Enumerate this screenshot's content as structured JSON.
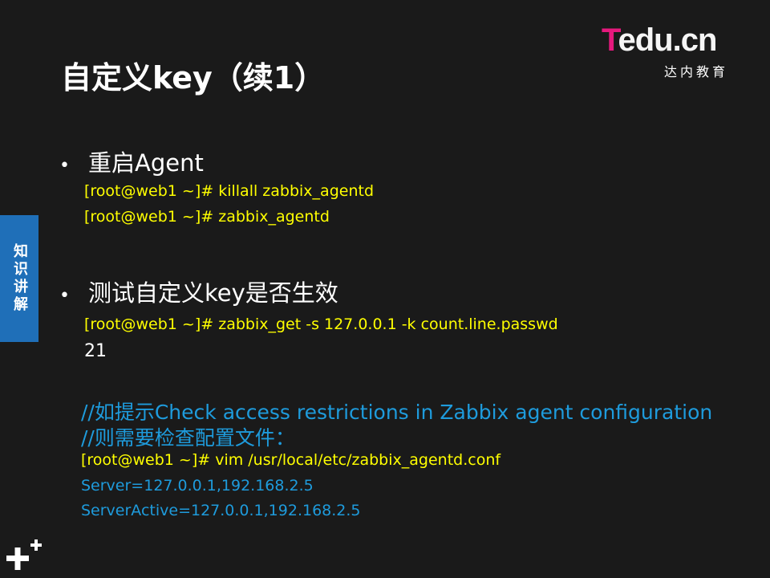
{
  "title": "自定义key（续1）",
  "logo": {
    "brand_t": "T",
    "brand_rest": "edu.cn",
    "subtitle": "达内教育"
  },
  "side_tab": "知识讲解",
  "sections": [
    {
      "bullet": "•",
      "heading": "重启Agent",
      "commands": [
        "[root@web1 ~]# killall  zabbix_agentd",
        "[root@web1 ~]# zabbix_agentd"
      ]
    },
    {
      "bullet": "•",
      "heading": "测试自定义key是否生效",
      "commands": [
        "[root@web1 ~]# zabbix_get -s 127.0.0.1 -k count.line.passwd"
      ],
      "output": "21"
    }
  ],
  "notes": [
    "//如提示Check access restrictions in Zabbix agent configuration",
    "//则需要检查配置文件："
  ],
  "config_command": "[root@web1 ~]# vim /usr/local/etc/zabbix_agentd.conf",
  "config_lines": [
    "Server=127.0.0.1,192.168.2.5",
    "ServerActive=127.0.0.1,192.168.2.5"
  ],
  "colors": {
    "background": "#1a1a1a",
    "command": "#ffff00",
    "note": "#1e9bdc",
    "side_tab": "#1f6fb8",
    "logo_accent": "#e6197d"
  }
}
